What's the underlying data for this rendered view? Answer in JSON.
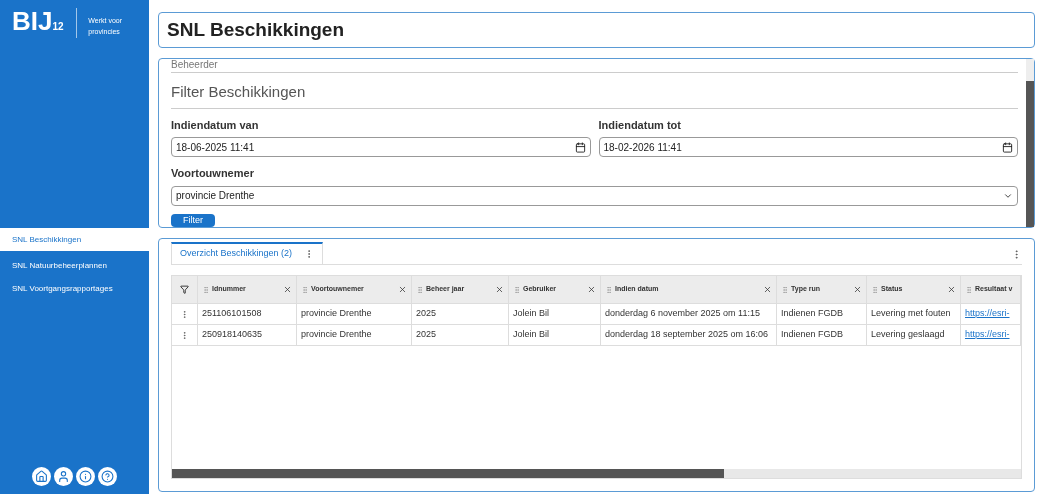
{
  "sidebar": {
    "logo": {
      "mark": "BIJ",
      "sub": "12",
      "tagline": "Werkt voor provincies"
    },
    "items": [
      {
        "label": "SNL Beschikkingen",
        "selected": true
      },
      {
        "label": "SNL Natuurbeheerplannen",
        "selected": false
      },
      {
        "label": "SNL Voortgangsrapportages",
        "selected": false
      }
    ]
  },
  "page_title": "SNL Beschikkingen",
  "filter": {
    "section_above": "Beheerder",
    "title": "Filter Beschikkingen",
    "fields": [
      {
        "kind": "date",
        "label": "Indiendatum van",
        "value": "18-06-2025 11:41"
      },
      {
        "kind": "date",
        "label": "Indiendatum tot",
        "value": "18-02-2026 11:41"
      },
      {
        "kind": "select",
        "label": "Voortouwnemer",
        "value": "provincie Drenthe"
      }
    ],
    "button": "Filter"
  },
  "results": {
    "tabs": [
      {
        "label": "Overzicht Beschikkingen (2)",
        "selected": true
      }
    ],
    "table": {
      "columns": [
        "Idnummer",
        "Voortouwnemer",
        "Beheer jaar",
        "Gebruiker",
        "Indien datum",
        "Type run",
        "Status",
        "Resultaat v"
      ],
      "rows": [
        [
          "251106101508",
          "provincie Drenthe",
          "2025",
          "Jolein Bil",
          "donderdag 6 november 2025 om 11:15",
          "Indienen FGDB",
          "Levering met fouten",
          "https://esri-"
        ],
        [
          "250918140635",
          "provincie Drenthe",
          "2025",
          "Jolein Bil",
          "donderdag 18 september 2025 om 16:06",
          "Indienen FGDB",
          "Levering geslaagd",
          "https://esri-"
        ]
      ]
    }
  }
}
